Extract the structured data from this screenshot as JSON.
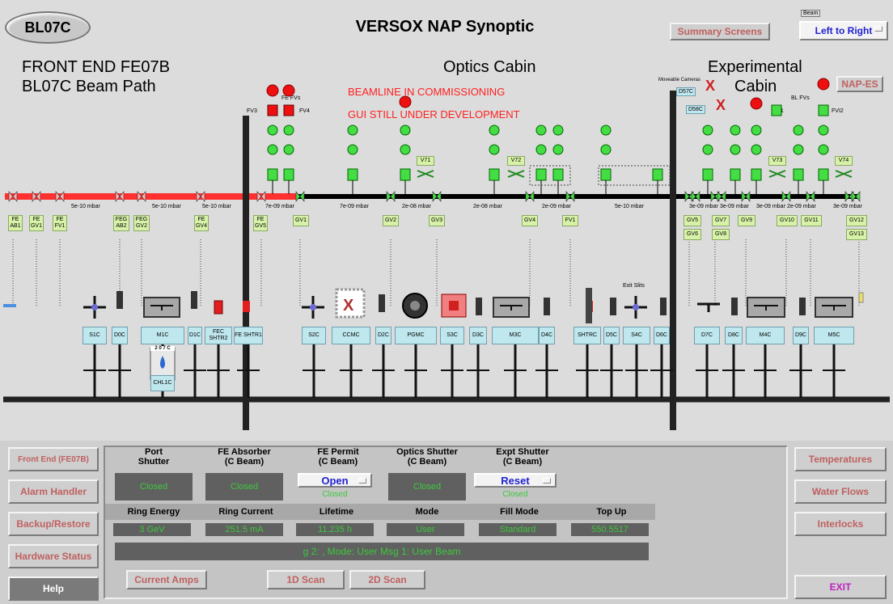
{
  "header": {
    "beamline": "BL07C",
    "title": "VERSOX NAP Synoptic",
    "summary_btn": "Summary Screens",
    "beam_label": "Beam",
    "beam_dir": "Left to Right"
  },
  "sections": {
    "frontend_line1": "FRONT END FE07B",
    "frontend_line2": "BL07C Beam Path",
    "optics": "Optics Cabin",
    "exp_line1": "Experimental",
    "exp_line2": "Cabin",
    "nap_es": "NAP-ES"
  },
  "notices": [
    "BEAMLINE IN COMMISSIONING",
    "GUI STILL UNDER DEVELOPMENT"
  ],
  "small_labels": {
    "fe_fvs": "FE FVs",
    "fv3": "FV3",
    "fv4": "FV4",
    "movable_cameras": "Moveable Cameras",
    "d57c": "D57C",
    "d58c": "D58C",
    "bl_fvs": "BL FVs",
    "fvi1": "FVI1",
    "fvi2": "FVI2",
    "exit_slits": "Exit Slits",
    "chl": "2 0 7 C"
  },
  "pressures": [
    "5e-10 mbar",
    "5e-10 mbar",
    "5e-10 mbar",
    "7e-09 mbar",
    "7e-09 mbar",
    "2e-08 mbar",
    "2e-08 mbar",
    "2e-09 mbar",
    "5e-10 mbar",
    "3e-09 mbar",
    "3e-09 mbar",
    "3e-09 mbar",
    "2e-09 mbar",
    "3e-09 mbar"
  ],
  "valves": [
    {
      "id": "fe-ab1",
      "label": "FE AB1"
    },
    {
      "id": "fe-gv1",
      "label": "FE GV1"
    },
    {
      "id": "fe-fv1",
      "label": "FE FV1"
    },
    {
      "id": "feg-ab2",
      "label": "FEG AB2"
    },
    {
      "id": "feg-gv2",
      "label": "FEG GV2"
    },
    {
      "id": "fe-gv4",
      "label": "FE GV4"
    },
    {
      "id": "fe-gv5",
      "label": "FE GV5"
    },
    {
      "id": "gv1",
      "label": "GV1"
    },
    {
      "id": "gv2",
      "label": "GV2"
    },
    {
      "id": "gv3",
      "label": "GV3"
    },
    {
      "id": "gv4",
      "label": "GV4"
    },
    {
      "id": "fv1",
      "label": "FV1"
    },
    {
      "id": "gv5",
      "label": "GV5"
    },
    {
      "id": "gv6",
      "label": "GV6"
    },
    {
      "id": "gv7",
      "label": "GV7"
    },
    {
      "id": "gv8",
      "label": "GV8"
    },
    {
      "id": "gv9",
      "label": "GV9"
    },
    {
      "id": "gv10",
      "label": "GV10"
    },
    {
      "id": "gv11",
      "label": "GV11"
    },
    {
      "id": "gv12",
      "label": "GV12"
    },
    {
      "id": "gv13",
      "label": "GV13"
    },
    {
      "id": "v71",
      "label": "V71"
    },
    {
      "id": "v72",
      "label": "V72"
    },
    {
      "id": "v73",
      "label": "V73"
    },
    {
      "id": "v74",
      "label": "V74"
    }
  ],
  "stations": [
    {
      "id": "s1c",
      "label": "S1C"
    },
    {
      "id": "d1c-a",
      "label": "D0C"
    },
    {
      "id": "m1c",
      "label": "M1C"
    },
    {
      "id": "d1c",
      "label": "D1C"
    },
    {
      "id": "fec-shtr2",
      "label": "FEC SHTR2"
    },
    {
      "id": "fe-shtr1",
      "label": "FE SHTR1"
    },
    {
      "id": "s2c",
      "label": "S2C"
    },
    {
      "id": "ccmc",
      "label": "CCMC"
    },
    {
      "id": "d2c",
      "label": "D2C"
    },
    {
      "id": "pgmc",
      "label": "PGMC"
    },
    {
      "id": "s3c",
      "label": "S3C"
    },
    {
      "id": "d3c",
      "label": "D3C"
    },
    {
      "id": "m3c",
      "label": "M3C"
    },
    {
      "id": "d4c",
      "label": "D4C"
    },
    {
      "id": "shtrc",
      "label": "SHTRC"
    },
    {
      "id": "d5c",
      "label": "D5C"
    },
    {
      "id": "s4c",
      "label": "S4C"
    },
    {
      "id": "d6c",
      "label": "D6C"
    },
    {
      "id": "d7c",
      "label": "D7C"
    },
    {
      "id": "d8c",
      "label": "D8C"
    },
    {
      "id": "m4c",
      "label": "M4C"
    },
    {
      "id": "d9c",
      "label": "D9C"
    },
    {
      "id": "m5c",
      "label": "M5C"
    },
    {
      "id": "chl1c",
      "label": "CHL1C"
    }
  ],
  "left_nav": [
    "Front End (FE07B)",
    "Alarm Handler",
    "Backup/Restore",
    "Hardware Status",
    "Help"
  ],
  "right_nav": [
    "Temperatures",
    "Water Flows",
    "Interlocks",
    "EXIT"
  ],
  "shutters": {
    "headers": [
      "Port\nShutter",
      "FE Absorber\n(C Beam)",
      "FE Permit\n(C Beam)",
      "Optics Shutter\n(C Beam)",
      "Expt Shutter\n(C Beam)"
    ],
    "values": [
      "Closed",
      "Closed",
      "",
      "Closed",
      ""
    ],
    "permit_btn": "Open",
    "permit_state": "Closed",
    "expt_btn": "Reset",
    "expt_state": "Closed"
  },
  "ring": {
    "headers": [
      "Ring Energy",
      "Ring Current",
      "Lifetime",
      "Mode",
      "Fill Mode",
      "Top Up"
    ],
    "values": [
      "3 GeV",
      "251.5 mA",
      "11.235 h",
      "User",
      "Standard",
      "550.5517"
    ]
  },
  "message": "g 2: ,  Mode: User   Msg 1: User Beam",
  "action_btns": [
    "Current Amps",
    "1D Scan",
    "2D Scan"
  ],
  "colors": {
    "beam_red": "#ff2020",
    "status_green": "#3cc83c",
    "valve_green": "#22cc22",
    "exit_magenta": "#c020c0",
    "notice_red": "#ff2020"
  }
}
